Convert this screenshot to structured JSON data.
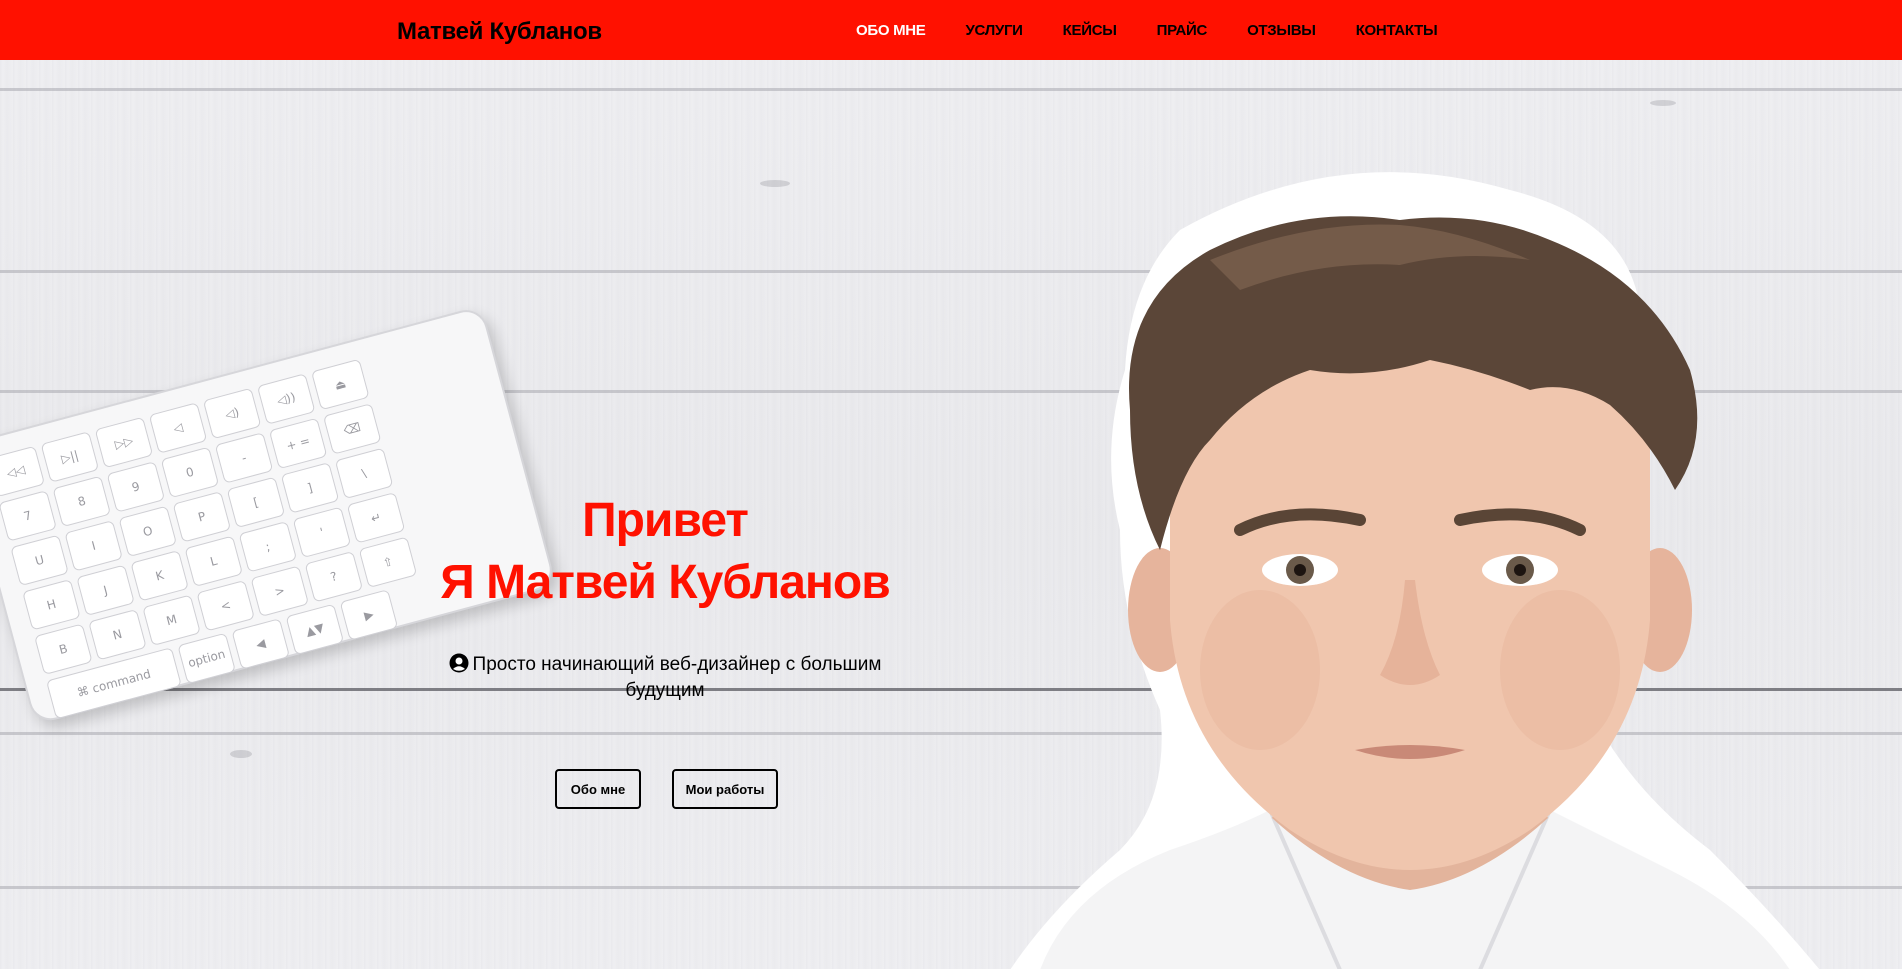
{
  "header": {
    "logo": "Матвей Кубланов",
    "nav": [
      {
        "label": "ОБО МНЕ",
        "active": true
      },
      {
        "label": "УСЛУГИ"
      },
      {
        "label": "КЕЙСЫ"
      },
      {
        "label": "ПРАЙС"
      },
      {
        "label": "ОТЗЫВЫ"
      },
      {
        "label": "КОНТАКТЫ"
      }
    ]
  },
  "hero": {
    "title_line1": "Привет",
    "title_line2": "Я Матвей Кубланов",
    "subtitle": "Просто начинающий веб-дизайнер с большим будущим",
    "buttons": {
      "about": "Обо мне",
      "works": "Мои работы"
    }
  },
  "keyboard": {
    "rows": [
      [
        "◁◁",
        "▷||",
        "▷▷",
        "◁",
        "◁)",
        "◁))",
        "⏏"
      ],
      [
        "7",
        "8",
        "9",
        "0",
        "-",
        "+ =",
        "⌫"
      ],
      [
        "U",
        "I",
        "O",
        "P",
        "[",
        "]",
        "\\"
      ],
      [
        "H",
        "J",
        "K",
        "L",
        ";",
        "'",
        "↵"
      ],
      [
        "B",
        "N",
        "M",
        "<",
        ">",
        "?",
        "⇧"
      ],
      [
        "⌘ command",
        "option",
        "◀",
        "▲▼",
        "▶"
      ]
    ]
  },
  "colors": {
    "accent": "#ff1100",
    "header_bg": "#ff1100",
    "nav_active": "#ffffff",
    "text": "#000000"
  },
  "icons": {
    "subtitle_icon": "user-circle-icon"
  }
}
